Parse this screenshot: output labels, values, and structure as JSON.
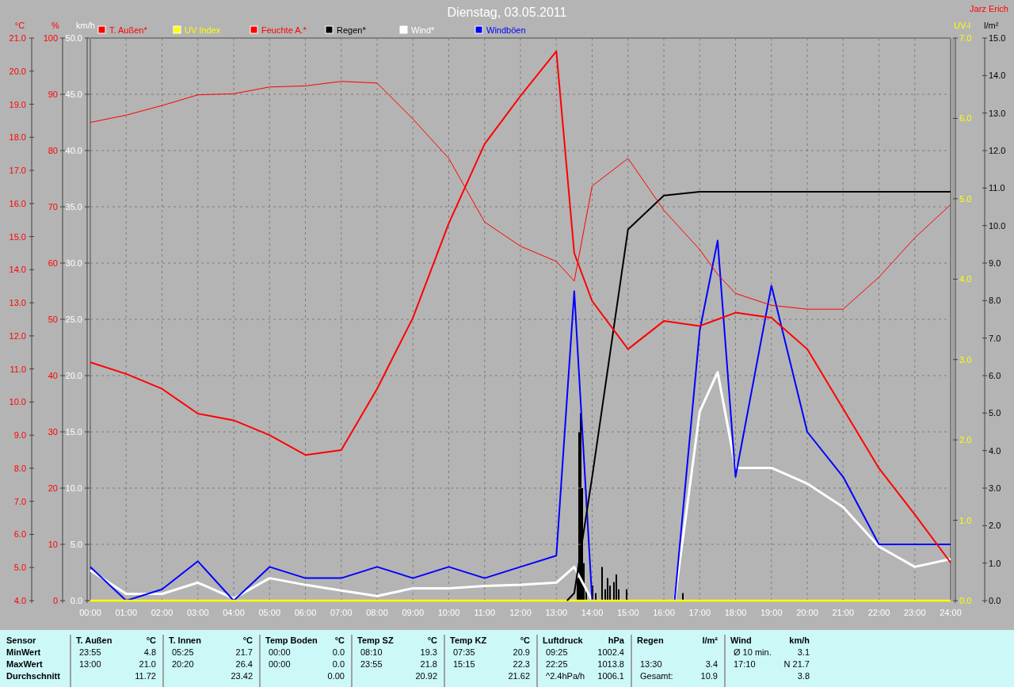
{
  "title": "Dienstag, 03.05.2011",
  "author": "Jarz Erich",
  "layers": [
    {
      "chart_data": {
        "type": "line",
        "ylabel": "°C",
        "xlim": [
          0,
          24
        ],
        "ylim": [
          4,
          21
        ],
        "yticks": [
          {
            "value": 4,
            "label": "4.0"
          },
          {
            "value": 5,
            "label": "5.0"
          },
          {
            "value": 6,
            "label": "6.0"
          },
          {
            "value": 7,
            "label": "7.0"
          },
          {
            "value": 8,
            "label": "8.0"
          },
          {
            "value": 9,
            "label": "9.0"
          },
          {
            "value": 10,
            "label": "10.0"
          },
          {
            "value": 11,
            "label": "11.0"
          },
          {
            "value": 12,
            "label": "12.0"
          },
          {
            "value": 13,
            "label": "13.0"
          },
          {
            "value": 14,
            "label": "14.0"
          },
          {
            "value": 15,
            "label": "15.0"
          },
          {
            "value": 16,
            "label": "16.0"
          },
          {
            "value": 17,
            "label": "17.0"
          },
          {
            "value": 18,
            "label": "18.0"
          },
          {
            "value": 19,
            "label": "19.0"
          },
          {
            "value": 20,
            "label": "20.0"
          },
          {
            "value": 21,
            "label": "21.0"
          }
        ],
        "x": [
          0,
          1,
          2,
          3,
          4,
          5,
          6,
          7,
          8,
          9,
          10,
          11,
          12,
          13,
          13.5,
          14,
          15,
          16,
          17,
          17.5,
          18,
          19,
          20,
          21,
          22,
          23,
          24
        ],
        "series": [
          {
            "name": "T. Außen*",
            "color": "#ff0000",
            "values": [
              11.2,
              10.85,
              10.4,
              9.65,
              9.45,
              9.0,
              8.4,
              8.55,
              10.4,
              12.55,
              15.4,
              17.8,
              19.25,
              20.6,
              14.5,
              13.05,
              11.6,
              12.45,
              12.3,
              12.5,
              12.7,
              12.55,
              11.6,
              9.8,
              8.0,
              6.6,
              5.15
            ]
          }
        ]
      }
    },
    {
      "chart_data": {
        "type": "line",
        "ylabel": "UV-I",
        "xlim": [
          0,
          24
        ],
        "ylim": [
          0,
          7
        ],
        "yticks": [
          {
            "value": 0,
            "label": "0.0"
          },
          {
            "value": 1,
            "label": "1.0"
          },
          {
            "value": 2,
            "label": "2.0"
          },
          {
            "value": 3,
            "label": "3.0"
          },
          {
            "value": 4,
            "label": "4.0"
          },
          {
            "value": 5,
            "label": "5.0"
          },
          {
            "value": 6,
            "label": "6.0"
          },
          {
            "value": 7,
            "label": "7.0"
          }
        ],
        "x": [
          0,
          1,
          2,
          3,
          4,
          5,
          6,
          7,
          8,
          9,
          10,
          11,
          12,
          13,
          14,
          15,
          16,
          17,
          18,
          19,
          20,
          21,
          22,
          23,
          24
        ],
        "series": [
          {
            "name": "UV Index",
            "color": "#ffff00",
            "values": [
              0,
              0,
              0,
              0,
              0,
              0,
              0,
              0,
              0,
              0,
              0,
              0,
              0,
              0,
              0,
              0,
              0,
              0,
              0,
              0,
              0,
              0,
              0,
              0,
              0
            ]
          }
        ]
      }
    },
    {
      "chart_data": {
        "type": "line",
        "ylabel": "%",
        "xlim": [
          0,
          24
        ],
        "ylim": [
          0,
          100
        ],
        "yticks": [
          {
            "value": 0,
            "label": "0"
          },
          {
            "value": 10,
            "label": "10"
          },
          {
            "value": 20,
            "label": "20"
          },
          {
            "value": 30,
            "label": "30"
          },
          {
            "value": 40,
            "label": "40"
          },
          {
            "value": 50,
            "label": "50"
          },
          {
            "value": 60,
            "label": "60"
          },
          {
            "value": 70,
            "label": "70"
          },
          {
            "value": 80,
            "label": "80"
          },
          {
            "value": 90,
            "label": "90"
          },
          {
            "value": 100,
            "label": "100"
          }
        ],
        "x": [
          0,
          1,
          2,
          3,
          4,
          5,
          6,
          7,
          8,
          9,
          10,
          11,
          12,
          13,
          13.5,
          14,
          15,
          16,
          17,
          17.5,
          18,
          19,
          20,
          21,
          22,
          23,
          24
        ],
        "series": [
          {
            "name": "Feuchte A.*",
            "color": "#ff0000",
            "values": [
              85,
              86.3,
              88,
              89.9,
              90.1,
              91.3,
              91.5,
              92.3,
              92,
              85.6,
              78.6,
              67.3,
              63,
              60.3,
              56.8,
              73.7,
              78.6,
              69.4,
              62.4,
              58,
              54.6,
              52.5,
              51.8,
              51.8,
              57.5,
              64.5,
              70.4
            ]
          }
        ]
      }
    },
    {
      "chart_data": {
        "type": "line",
        "ylabel": "l/m²",
        "xlim": [
          0,
          24
        ],
        "ylim": [
          0,
          15
        ],
        "yticks": [
          {
            "value": 0,
            "label": "0.0"
          },
          {
            "value": 1,
            "label": "1.0"
          },
          {
            "value": 2,
            "label": "2.0"
          },
          {
            "value": 3,
            "label": "3.0"
          },
          {
            "value": 4,
            "label": "4.0"
          },
          {
            "value": 5,
            "label": "5.0"
          },
          {
            "value": 6,
            "label": "6.0"
          },
          {
            "value": 7,
            "label": "7.0"
          },
          {
            "value": 8,
            "label": "8.0"
          },
          {
            "value": 9,
            "label": "9.0"
          },
          {
            "value": 10,
            "label": "10.0"
          },
          {
            "value": 11,
            "label": "11.0"
          },
          {
            "value": 12,
            "label": "12.0"
          },
          {
            "value": 13,
            "label": "13.0"
          },
          {
            "value": 14,
            "label": "14.0"
          },
          {
            "value": 15,
            "label": "15.0"
          }
        ],
        "x": [
          13.3,
          13.5,
          14,
          15,
          16,
          17,
          18,
          19,
          20,
          21,
          22,
          23,
          24
        ],
        "series": [
          {
            "name": "Regen*",
            "color": "#000000",
            "values": [
              0,
              0.2,
              3.3,
              9.9,
              10.8,
              10.9,
              10.9,
              10.9,
              10.9,
              10.9,
              10.9,
              10.9,
              10.9
            ]
          }
        ]
      }
    },
    {
      "chart_data": {
        "type": "line",
        "ylabel": "km/h",
        "xlim": [
          0,
          24
        ],
        "ylim": [
          0,
          50
        ],
        "yticks": [
          {
            "value": 0,
            "label": "0.0"
          },
          {
            "value": 5,
            "label": "5.0"
          },
          {
            "value": 10,
            "label": "10.0"
          },
          {
            "value": 15,
            "label": "15.0"
          },
          {
            "value": 20,
            "label": "20.0"
          },
          {
            "value": 25,
            "label": "25.0"
          },
          {
            "value": 30,
            "label": "30.0"
          },
          {
            "value": 35,
            "label": "35.0"
          },
          {
            "value": 40,
            "label": "40.0"
          },
          {
            "value": 45,
            "label": "45.0"
          },
          {
            "value": 50,
            "label": "50.0"
          }
        ],
        "xticks": [
          {
            "value": 0,
            "label": "00:00"
          },
          {
            "value": 1,
            "label": "01:00"
          },
          {
            "value": 2,
            "label": "02:00"
          },
          {
            "value": 3,
            "label": "03:00"
          },
          {
            "value": 4,
            "label": "04:00"
          },
          {
            "value": 5,
            "label": "05:00"
          },
          {
            "value": 6,
            "label": "06:00"
          },
          {
            "value": 7,
            "label": "07:00"
          },
          {
            "value": 8,
            "label": "08:00"
          },
          {
            "value": 9,
            "label": "09:00"
          },
          {
            "value": 10,
            "label": "10:00"
          },
          {
            "value": 11,
            "label": "11:00"
          },
          {
            "value": 12,
            "label": "12:00"
          },
          {
            "value": 13,
            "label": "13:00"
          },
          {
            "value": 14,
            "label": "14:00"
          },
          {
            "value": 15,
            "label": "15:00"
          },
          {
            "value": 16,
            "label": "16:00"
          },
          {
            "value": 17,
            "label": "17:00"
          },
          {
            "value": 18,
            "label": "18:00"
          },
          {
            "value": 19,
            "label": "19:00"
          },
          {
            "value": 20,
            "label": "20:00"
          },
          {
            "value": 21,
            "label": "21:00"
          },
          {
            "value": 22,
            "label": "22:00"
          },
          {
            "value": 23,
            "label": "23:00"
          },
          {
            "value": 24,
            "label": "24:00"
          }
        ],
        "grid": true,
        "x": [
          0,
          1,
          2,
          3,
          4,
          5,
          6,
          7,
          8,
          9,
          10,
          11,
          12,
          13,
          13.5,
          14,
          16.3,
          17,
          17.5,
          18,
          19,
          20,
          21,
          22,
          23,
          24
        ],
        "series": [
          {
            "name": "Wind*",
            "color": "#ffffff",
            "values": [
              2.7,
              0.6,
              0.6,
              1.6,
              0.2,
              2,
              1.4,
              0.9,
              0.4,
              1.1,
              1.1,
              1.3,
              1.4,
              1.6,
              3,
              0,
              0,
              16.8,
              20.3,
              11.8,
              11.8,
              10.4,
              8.3,
              4.8,
              3,
              3.7
            ]
          },
          {
            "name": "Windböen",
            "color": "#0000ff",
            "values": [
              3,
              0,
              1,
              3.5,
              0,
              3,
              2,
              2,
              3,
              2,
              3,
              2,
              3,
              4,
              27.5,
              0,
              0,
              24,
              32,
              11,
              28,
              15,
              11,
              5,
              5,
              5
            ]
          }
        ]
      }
    }
  ],
  "stats": {
    "row_labels": [
      "Sensor",
      "MinWert",
      "MaxWert",
      "Durchschnitt"
    ],
    "groups": [
      {
        "name": "T. Außen",
        "unit": "°C",
        "rows": [
          {
            "time": "23:55",
            "value": "4.8"
          },
          {
            "time": "13:00",
            "value": "21.0"
          },
          {
            "value": "11.72"
          }
        ]
      },
      {
        "name": "T. Innen",
        "unit": "°C",
        "rows": [
          {
            "time": "05:25",
            "value": "21.7"
          },
          {
            "time": "20:20",
            "value": "26.4"
          },
          {
            "value": "23.42"
          }
        ]
      },
      {
        "name": "Temp Boden",
        "unit": "°C",
        "rows": [
          {
            "time": "00:00",
            "value": "0.0"
          },
          {
            "time": "00:00",
            "value": "0.0"
          },
          {
            "value": "0.00"
          }
        ]
      },
      {
        "name": "Temp SZ",
        "unit": "°C",
        "rows": [
          {
            "time": "08:10",
            "value": "19.3"
          },
          {
            "time": "23:55",
            "value": "21.8"
          },
          {
            "value": "20.92"
          }
        ]
      },
      {
        "name": "Temp KZ",
        "unit": "°C",
        "rows": [
          {
            "time": "07:35",
            "value": "20.9"
          },
          {
            "time": "15:15",
            "value": "22.3"
          },
          {
            "value": "21.62"
          }
        ]
      },
      {
        "name": "Luftdruck",
        "unit": "hPa",
        "rows": [
          {
            "time": "09:25",
            "value": "1002.4"
          },
          {
            "time": "22:25",
            "value": "1013.8"
          },
          {
            "time": "^2.4hPa/h",
            "value": "1006.1"
          }
        ]
      },
      {
        "name": "Regen",
        "unit": "l/m²",
        "rows": [
          null,
          {
            "time": "13:30",
            "value": "3.4"
          },
          {
            "time": "Gesamt:",
            "value": "10.9"
          }
        ]
      },
      {
        "name": "Wind",
        "unit": "km/h",
        "rows": [
          {
            "time": "Ø 10 min.",
            "value": "3.1"
          },
          {
            "time": "17:10",
            "value": "N 21.7"
          },
          {
            "value": "3.8"
          }
        ]
      }
    ]
  }
}
